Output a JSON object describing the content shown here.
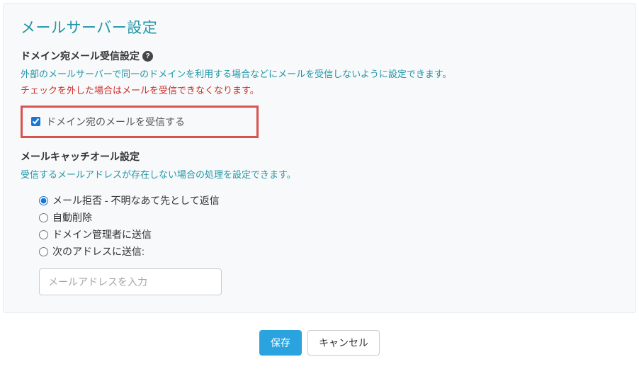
{
  "panel": {
    "title": "メールサーバー設定"
  },
  "domainMail": {
    "heading": "ドメイン宛メール受信設定",
    "desc1": "外部のメールサーバーで同一のドメインを利用する場合などにメールを受信しないように設定できます。",
    "desc2": "チェックを外した場合はメールを受信できなくなります。",
    "checkbox_label": "ドメイン宛のメールを受信する",
    "checkbox_checked": true
  },
  "catchAll": {
    "heading": "メールキャッチオール設定",
    "desc": "受信するメールアドレスが存在しない場合の処理を設定できます。",
    "options": [
      "メール拒否 - 不明なあて先として返信",
      "自動削除",
      "ドメイン管理者に送信",
      "次のアドレスに送信:"
    ],
    "selected": 0,
    "address_placeholder": "メールアドレスを入力"
  },
  "footer": {
    "save": "保存",
    "cancel": "キャンセル"
  },
  "icons": {
    "help_glyph": "?"
  }
}
